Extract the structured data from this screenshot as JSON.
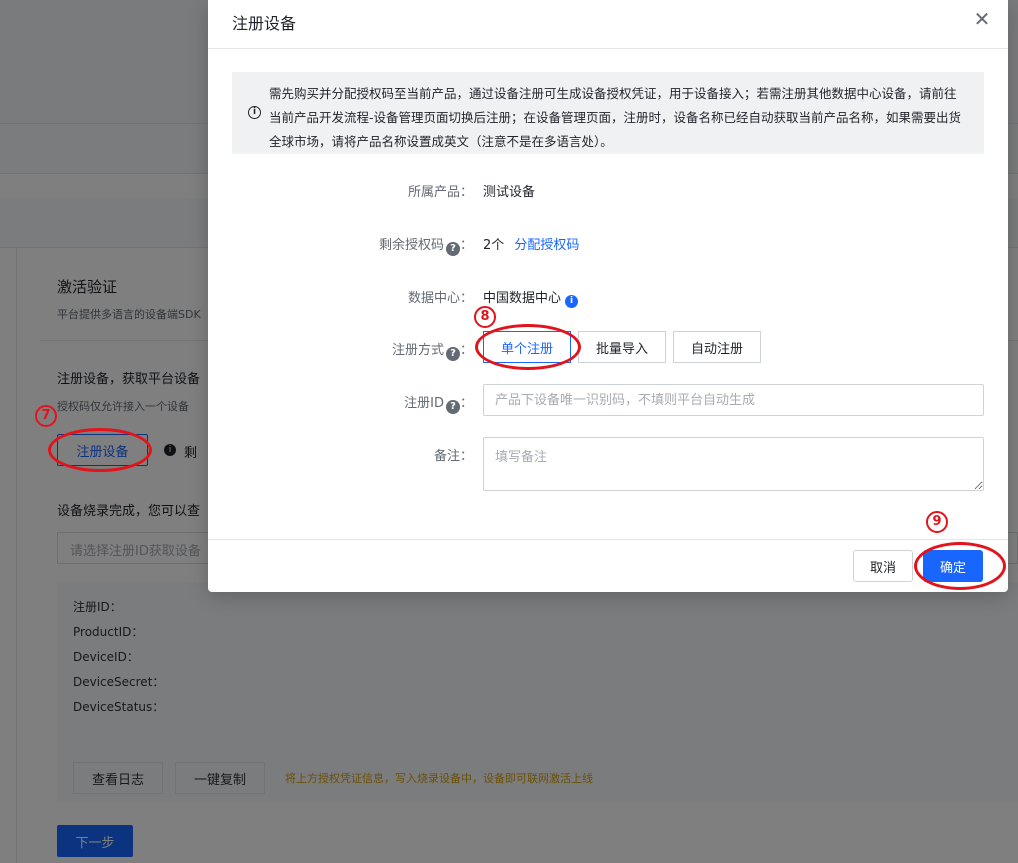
{
  "background": {
    "section_title": "激活验证",
    "section_desc": "平台提供多语言的设备端SDK",
    "register_heading": "注册设备，获取平台设备",
    "license_note": "授权码仅允许接入一个设备",
    "register_button": "注册设备",
    "remain_label": "剩",
    "burn_heading": "设备烧录完成，您可以查",
    "select_placeholder": "请选择注册ID获取设备",
    "detail_rows": [
      "注册ID：",
      "ProductID：",
      "DeviceID：",
      "DeviceSecret：",
      "DeviceStatus："
    ],
    "view_log_button": "查看日志",
    "copy_button": "一键复制",
    "tip_text": "将上方授权凭证信息，写入烧录设备中，设备即可联网激活上线",
    "next_button": "下一步"
  },
  "modal": {
    "title": "注册设备",
    "close_glyph": "✕",
    "notice": "需先购买并分配授权码至当前产品，通过设备注册可生成设备授权凭证，用于设备接入；若需注册其他数据中心设备，请前往当前产品开发流程-设备管理页面切换后注册；在设备管理页面，注册时，设备名称已经自动获取当前产品名称，如果需要出货全球市场，请将产品名称设置成英文（注意不是在多语言处）。",
    "product_label": "所属产品：",
    "product_value": "测试设备",
    "license_label": "剩余授权码",
    "license_count": "2个",
    "license_link": "分配授权码",
    "datacenter_label": "数据中心：",
    "datacenter_value": "中国数据中心",
    "method_label": "注册方式",
    "methods": [
      "单个注册",
      "批量导入",
      "自动注册"
    ],
    "regid_label": "注册ID",
    "regid_placeholder": "产品下设备唯一识别码，不填则平台自动生成",
    "remark_label": "备注：",
    "remark_placeholder": "填写备注",
    "cancel_button": "取消",
    "ok_button": "确定",
    "colon": "："
  },
  "annotations": {
    "step7": "7",
    "step8": "8",
    "step9": "9"
  },
  "colors": {
    "primary": "#1966ff",
    "annotation_red": "#e3131b",
    "tip_orange": "#d4a017"
  }
}
